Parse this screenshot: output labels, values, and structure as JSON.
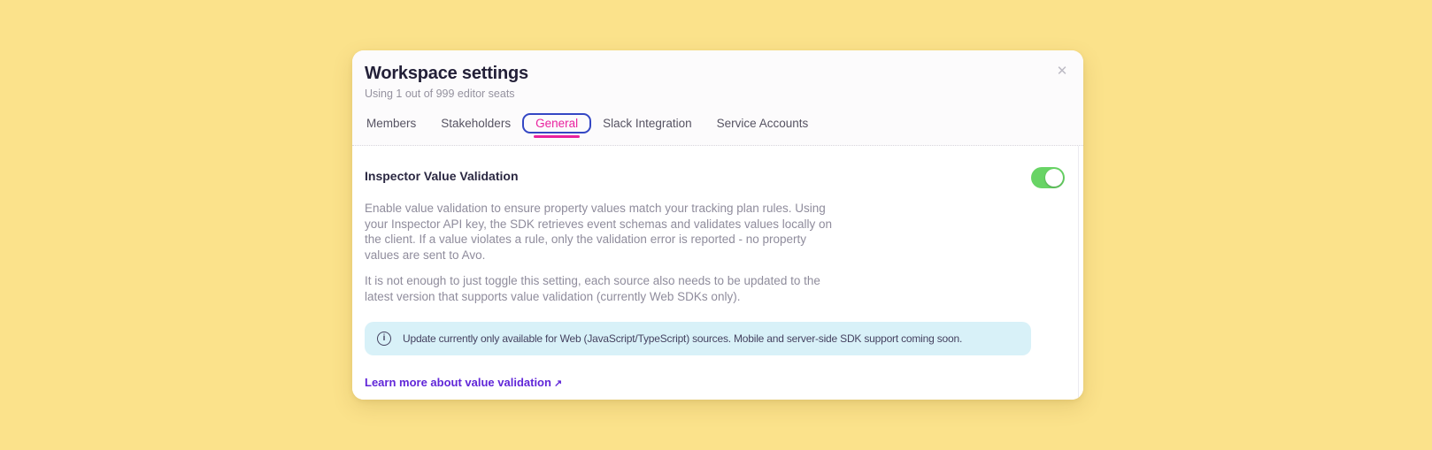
{
  "colors": {
    "page_background_yellow": "#fbe28b",
    "modal_background": "#ffffff",
    "header_background": "#fcfbfc",
    "active_tab_pink": "#e9219e",
    "focus_ring_blue": "#3447c4",
    "toggle_on_green": "#68d465",
    "info_banner_background": "#d8f1f8",
    "link_purple": "#6127d8",
    "body_text_gray": "#8f8c9c",
    "heading_dark": "#232038"
  },
  "icons": {
    "close": "✕",
    "info": "i",
    "external_link": "↗"
  },
  "modal": {
    "title": "Workspace settings",
    "subtitle": "Using 1 out of 999 editor seats",
    "tabs": [
      {
        "label": "Members",
        "active": false
      },
      {
        "label": "Stakeholders",
        "active": false
      },
      {
        "label": "General",
        "active": true
      },
      {
        "label": "Slack Integration",
        "active": false
      },
      {
        "label": "Service Accounts",
        "active": false
      }
    ]
  },
  "content": {
    "heading": "Inspector Value Validation",
    "toggle": {
      "setting": "Inspector Value Validation",
      "state": "on"
    },
    "paragraph1": [
      "Enable value validation to ensure property values match your tracking plan rules. Using",
      "your Inspector API key, the SDK retrieves event schemas and validates values locally on",
      "the client. If a value violates a rule, only the validation error is reported - no property",
      "values are sent to Avo."
    ],
    "paragraph2": [
      "It is not enough to just toggle this setting, each source also needs to be updated to the",
      "latest version that supports value validation (currently Web SDKs only)."
    ],
    "banner_text": "Update currently only available for Web (JavaScript/TypeScript) sources. Mobile and server-side SDK support coming soon.",
    "link_label": "Learn more about value validation"
  }
}
